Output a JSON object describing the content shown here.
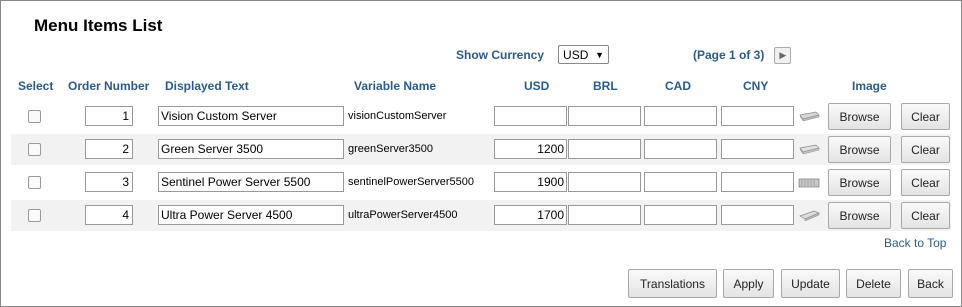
{
  "title": "Menu Items List",
  "currency": {
    "label": "Show Currency",
    "selected": "USD"
  },
  "paging": {
    "text": "(Page 1 of 3)"
  },
  "columns": {
    "select": "Select",
    "order": "Order Number",
    "displayed": "Displayed Text",
    "variable": "Variable Name",
    "usd": "USD",
    "brl": "BRL",
    "cad": "CAD",
    "cny": "CNY",
    "image": "Image"
  },
  "rows": [
    {
      "order": "1",
      "displayed": "Vision Custom Server",
      "variable": "visionCustomServer",
      "usd": "",
      "brl": "",
      "cad": "",
      "cny": "",
      "image_icon": "server-thumbnail-icon"
    },
    {
      "order": "2",
      "displayed": "Green Server 3500",
      "variable": "greenServer3500",
      "usd": "1200",
      "brl": "",
      "cad": "",
      "cny": "",
      "image_icon": "server-thumbnail-icon"
    },
    {
      "order": "3",
      "displayed": "Sentinel Power Server 5500",
      "variable": "sentinelPowerServer5500",
      "usd": "1900",
      "brl": "",
      "cad": "",
      "cny": "",
      "image_icon": "server-thumbnail-icon"
    },
    {
      "order": "4",
      "displayed": "Ultra Power Server 4500",
      "variable": "ultraPowerServer4500",
      "usd": "1700",
      "brl": "",
      "cad": "",
      "cny": "",
      "image_icon": "server-thumbnail-icon"
    }
  ],
  "row_buttons": {
    "browse": "Browse",
    "clear": "Clear"
  },
  "back_to_top": "Back to Top",
  "footer": {
    "translations": "Translations",
    "apply": "Apply",
    "update": "Update",
    "delete": "Delete",
    "back": "Back"
  },
  "colors": {
    "link": "#2b5b8c",
    "row_alt": "#f2f2f2"
  }
}
